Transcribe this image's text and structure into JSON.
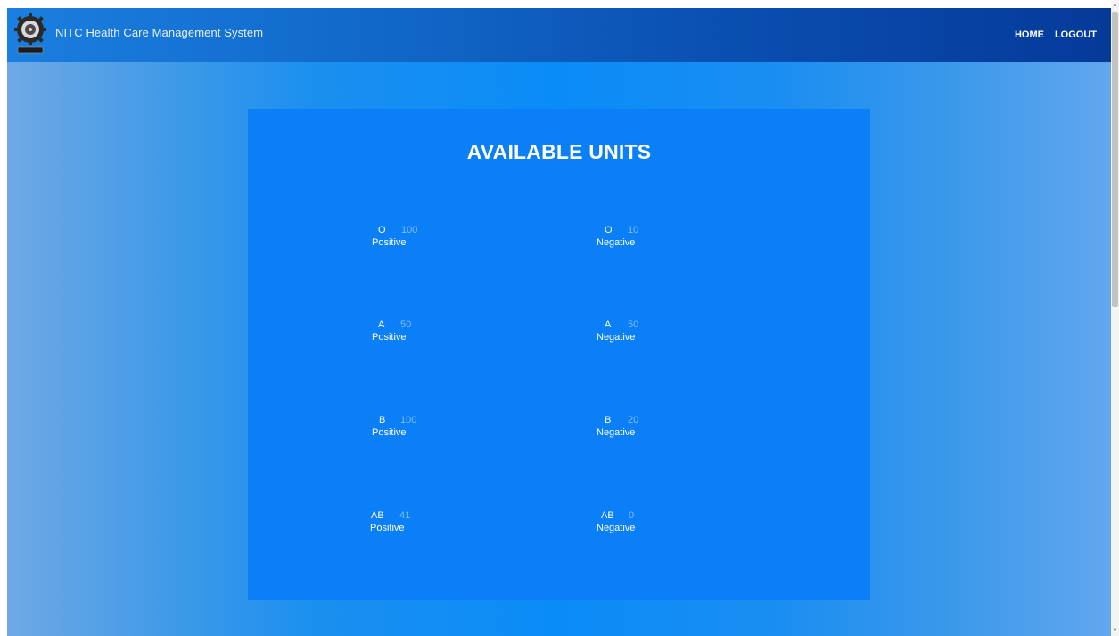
{
  "navbar": {
    "brand": "NITC Health Care Management System",
    "links": {
      "home": "HOME",
      "logout": "LOGOUT"
    }
  },
  "card": {
    "title": "AVAILABLE UNITS"
  },
  "units": [
    {
      "group": "O",
      "count": "100",
      "rh": "Positive"
    },
    {
      "group": "O",
      "count": "10",
      "rh": "Negative"
    },
    {
      "group": "A",
      "count": "50",
      "rh": "Positive"
    },
    {
      "group": "A",
      "count": "50",
      "rh": "Negative"
    },
    {
      "group": "B",
      "count": "100",
      "rh": "Positive"
    },
    {
      "group": "B",
      "count": "20",
      "rh": "Negative"
    },
    {
      "group": "AB",
      "count": "41",
      "rh": "Positive"
    },
    {
      "group": "AB",
      "count": "0",
      "rh": "Negative"
    }
  ],
  "colors": {
    "navbar_dark": "#053a9a",
    "card_bg": "#0a7ff8",
    "count_text": "#7fbfff"
  }
}
